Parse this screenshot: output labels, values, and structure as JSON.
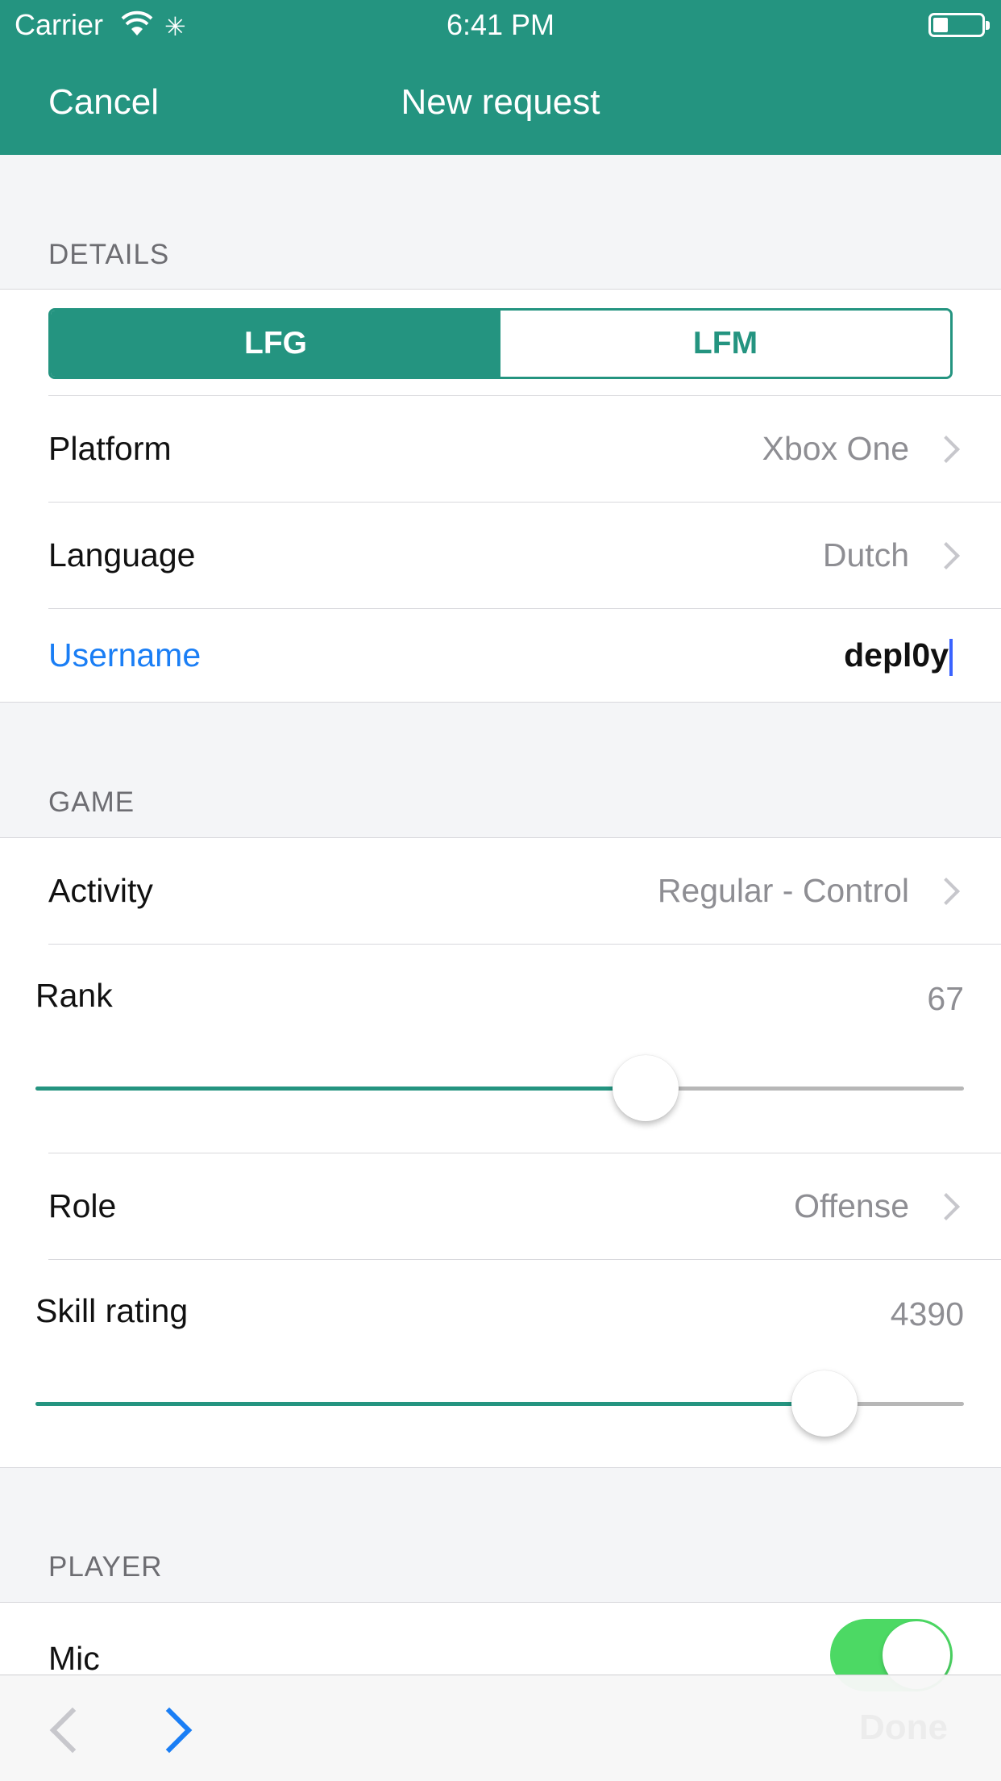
{
  "status_bar": {
    "carrier": "Carrier",
    "time": "6:41 PM"
  },
  "nav": {
    "cancel_label": "Cancel",
    "title": "New request"
  },
  "colors": {
    "accent": "#249480",
    "link": "#1a7ef5",
    "toggle_on": "#4cd964"
  },
  "details": {
    "header": "DETAILS",
    "segment": {
      "options": [
        "LFG",
        "LFM"
      ],
      "selected": "LFG"
    },
    "platform": {
      "label": "Platform",
      "value": "Xbox One"
    },
    "language": {
      "label": "Language",
      "value": "Dutch"
    },
    "username": {
      "label": "Username",
      "value": "depl0y"
    }
  },
  "game": {
    "header": "GAME",
    "activity": {
      "label": "Activity",
      "value": "Regular - Control"
    },
    "rank": {
      "label": "Rank",
      "value": "67",
      "fraction": 0.657
    },
    "role": {
      "label": "Role",
      "value": "Offense"
    },
    "skill_rating": {
      "label": "Skill rating",
      "value": "4390",
      "fraction": 0.85
    }
  },
  "player": {
    "header": "PLAYER",
    "mic": {
      "label": "Mic",
      "on": true
    }
  },
  "keyboard_toolbar": {
    "done_label": "Done",
    "icons": [
      "chevron-left-icon",
      "chevron-right-icon"
    ]
  }
}
